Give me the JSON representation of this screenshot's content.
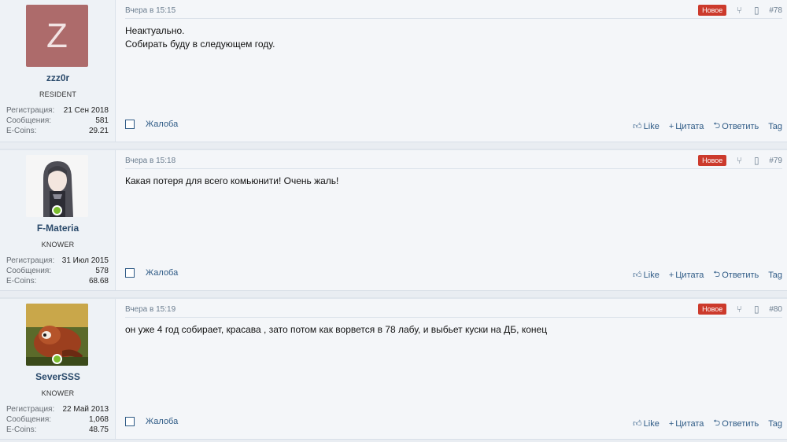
{
  "posts": [
    {
      "author": {
        "avatar_letter": "Z",
        "avatar_color": "#ad6b6b",
        "online": false,
        "name": "zzz0r",
        "title": "RESIDENT",
        "stats": [
          {
            "label": "Регистрация:",
            "value": "21 Сен 2018"
          },
          {
            "label": "Сообщения:",
            "value": "581"
          },
          {
            "label": "E-Coins:",
            "value": "29.21"
          }
        ]
      },
      "date": "Вчера в 15:15",
      "badge": "Новое",
      "number": "#78",
      "lines": [
        "Неактуально.",
        "Собирать буду в следующем году."
      ],
      "report": "Жалоба",
      "like": "Like",
      "quote": "Цитата",
      "reply": "Ответить",
      "tag": "Tag"
    },
    {
      "author": {
        "avatar_letter": "",
        "avatar_color": "#f2f2f2",
        "online": true,
        "name": "F-Materia",
        "title": "KNOWER",
        "stats": [
          {
            "label": "Регистрация:",
            "value": "31 Июл 2015"
          },
          {
            "label": "Сообщения:",
            "value": "578"
          },
          {
            "label": "E-Coins:",
            "value": "68.68"
          }
        ]
      },
      "date": "Вчера в 15:18",
      "badge": "Новое",
      "number": "#79",
      "lines": [
        "Какая потеря для всего комьюнити! Очень жаль!"
      ],
      "report": "Жалоба",
      "like": "Like",
      "quote": "Цитата",
      "reply": "Ответить",
      "tag": "Tag"
    },
    {
      "author": {
        "avatar_letter": "",
        "avatar_color": "#6b5a2a",
        "online": true,
        "name": "SeverSSS",
        "title": "KNOWER",
        "stats": [
          {
            "label": "Регистрация:",
            "value": "22 Май 2013"
          },
          {
            "label": "Сообщения:",
            "value": "1,068"
          },
          {
            "label": "E-Coins:",
            "value": "48.75"
          }
        ]
      },
      "date": "Вчера в 15:19",
      "badge": "Новое",
      "number": "#80",
      "lines": [
        "он уже 4 год собирает, красава , зато потом как ворвется в 78 лабу, и выбьет куски на ДБ, конец"
      ],
      "report": "Жалоба",
      "like": "Like",
      "quote": "Цитата",
      "reply": "Ответить",
      "tag": "Tag"
    }
  ]
}
